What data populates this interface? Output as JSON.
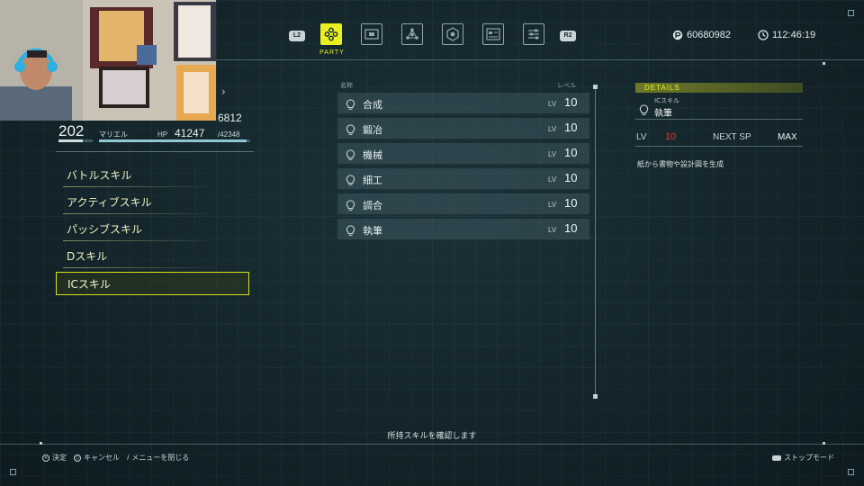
{
  "tabbar": {
    "left_shoulder": "L2",
    "right_shoulder": "R2",
    "active_caption": "PARTY",
    "tabs": [
      {
        "icon": "party-icon",
        "active": true
      },
      {
        "icon": "map-card-icon",
        "active": false
      },
      {
        "icon": "network-icon",
        "active": false
      },
      {
        "icon": "hexagon-badge-icon",
        "active": false
      },
      {
        "icon": "document-list-icon",
        "active": false
      },
      {
        "icon": "settings-sliders-icon",
        "active": false
      }
    ]
  },
  "status": {
    "currency": "60680982",
    "playtime": "112:46:19"
  },
  "character": {
    "sp": "6812",
    "level": "202",
    "name": "マリエル",
    "hp_label": "HP",
    "hp_current": "41247",
    "hp_max": "/42348",
    "hp_ratio": 0.974
  },
  "menu": {
    "items": [
      {
        "label": "バトルスキル"
      },
      {
        "label": "アクティブスキル"
      },
      {
        "label": "パッシブスキル"
      },
      {
        "label": "Dスキル"
      },
      {
        "label": "ICスキル"
      }
    ],
    "selected_index": 4
  },
  "skill_list": {
    "col_name": "名称",
    "col_level": "レベル",
    "lv_tag": "LV",
    "rows": [
      {
        "name": "合成",
        "level": "10"
      },
      {
        "name": "鍛冶",
        "level": "10"
      },
      {
        "name": "機械",
        "level": "10"
      },
      {
        "name": "細工",
        "level": "10"
      },
      {
        "name": "調合",
        "level": "10"
      },
      {
        "name": "執筆",
        "level": "10"
      }
    ]
  },
  "details": {
    "header": "DETAILS",
    "category": "ICスキル",
    "skill_name": "執筆",
    "lv_label": "LV",
    "lv_value": "10",
    "next_sp_label": "NEXT SP",
    "next_sp_value": "MAX",
    "description": "紙から書物や設計図を生成"
  },
  "help_text": "所持スキルを確認します",
  "footer": {
    "confirm": "決定",
    "cancel": "キャンセル",
    "close_menu": "メニューを閉じる",
    "stop_mode": "ストップモード"
  },
  "colors": {
    "accent_yellow": "#e8f020",
    "level_red": "#e03a3a",
    "background": "#14262c"
  }
}
